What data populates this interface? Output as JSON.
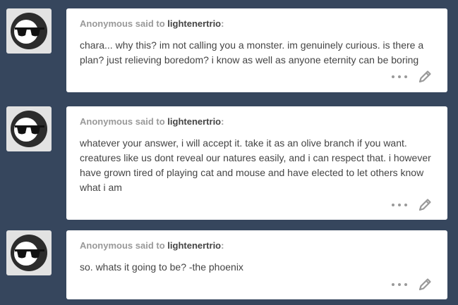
{
  "posts": [
    {
      "asker": "Anonymous",
      "said_to": "said to",
      "blog": "lightenertrio",
      "colon": ":",
      "question": "chara... why this? im not calling you a monster. im genuinely curious. is there a plan? just relieving boredom? i know as well as anyone eternity can be boring"
    },
    {
      "asker": "Anonymous",
      "said_to": "said to",
      "blog": "lightenertrio",
      "colon": ":",
      "question": "whatever your answer, i will accept it. take it as an olive branch if you want. creatures like us dont reveal our natures easily, and i can respect that. i however have grown tired of playing cat and mouse and have elected to let others know what i am"
    },
    {
      "asker": "Anonymous",
      "said_to": "said to",
      "blog": "lightenertrio",
      "colon": ":",
      "question": "so. whats it going to be? -the phoenix"
    }
  ],
  "icons": {
    "avatar": "anonymous-sunglasses-avatar",
    "more": "ellipsis-icon",
    "edit": "pencil-icon"
  },
  "colors": {
    "background": "#36465d",
    "card": "#ffffff",
    "asker": "#999999",
    "text": "#444444",
    "icon": "#999999"
  }
}
